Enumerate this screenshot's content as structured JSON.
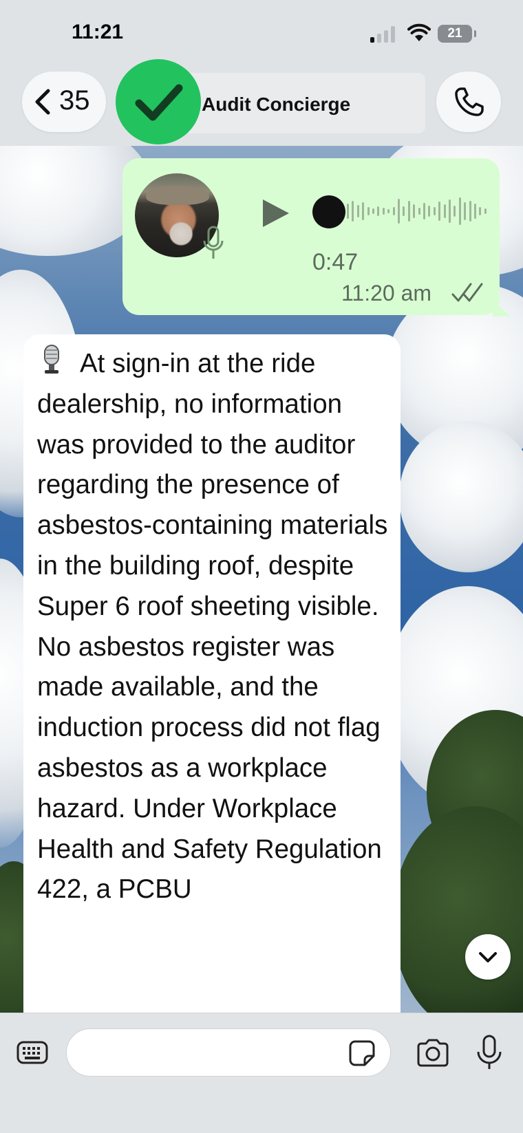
{
  "status_bar": {
    "time": "11:21",
    "battery_level": "21"
  },
  "header": {
    "back_count": "35",
    "chat_title": "Audit Concierge",
    "avatar_color": "#22c25f"
  },
  "voice_message": {
    "duration": "0:47",
    "sent_time": "11:20 am",
    "bubble_color": "#d9fdd3",
    "status": "read"
  },
  "transcription": {
    "icon": "studio-microphone-icon",
    "text": "At sign-in at the ride dealership, no information was provided to the auditor regarding the presence of asbestos-containing materials in the building roof, despite Super 6 roof sheeting visible. No asbestos register was made available, and the induction process did not flag asbestos as a workplace hazard. Under Workplace Health and Safety Regulation 422, a PCBU"
  },
  "composer": {
    "input_value": "",
    "input_placeholder": ""
  }
}
